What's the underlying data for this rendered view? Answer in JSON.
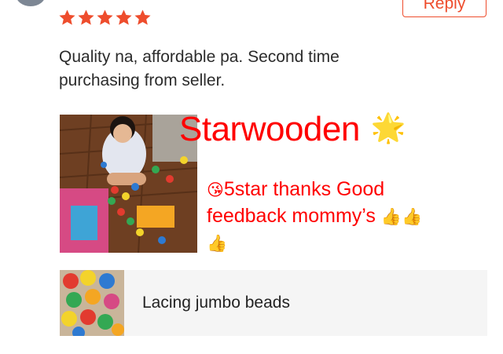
{
  "review": {
    "rating": 5,
    "star_color": "#ee4d2d",
    "reply_label": "Reply",
    "comment_line1": "Quality na, affordable pa. Second time",
    "comment_line2": "purchasing from seller."
  },
  "photo_overlay": {
    "title": "Starwooden",
    "title_emoji": "🌟",
    "message_emoji": "😘",
    "message_part1": "5star thanks Good",
    "message_part2": "feedback mommy’s",
    "thumbs_emoji": "👍",
    "text_color": "#ff0000"
  },
  "product": {
    "name": "Lacing jumbo beads"
  }
}
